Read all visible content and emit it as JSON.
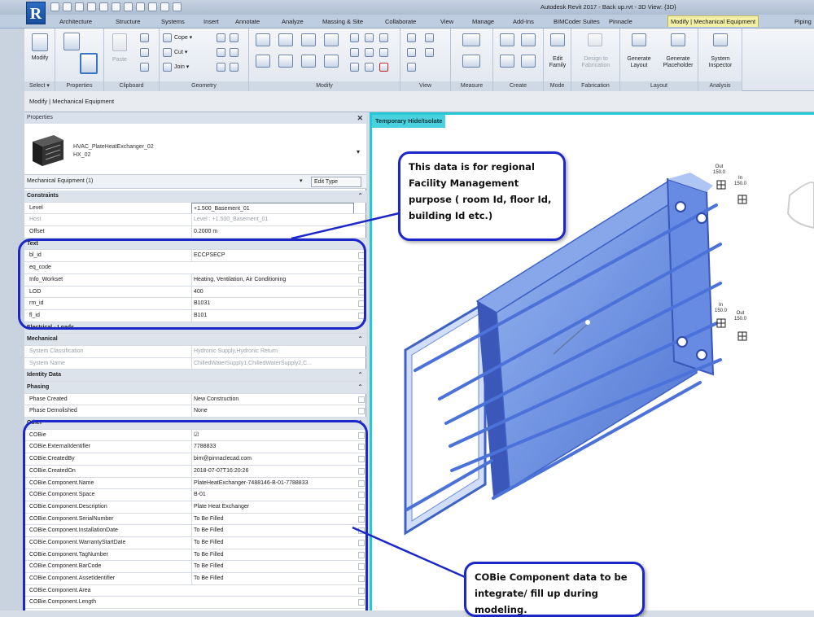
{
  "window": {
    "app_title": "Autodesk Revit 2017 -    Back up.rvt - 3D View: {3D}",
    "logo": "R"
  },
  "ribbon_tabs": [
    "Architecture",
    "Structure",
    "Systems",
    "Insert",
    "Annotate",
    "Analyze",
    "Massing & Site",
    "Collaborate",
    "View",
    "Manage",
    "Add-Ins",
    "BIMCoder Suites",
    "Pinnacle",
    "Modify | Mechanical Equipment",
    "Piping"
  ],
  "ribbon_groups": {
    "select": {
      "label": "Select ▾",
      "modify_label": "Modify"
    },
    "properties": {
      "label": "Properties"
    },
    "clipboard": {
      "label": "Clipboard",
      "paste": "Paste"
    },
    "geometry": {
      "label": "Geometry",
      "cope": "Cope ▾",
      "cut": "Cut ▾",
      "join": "Join ▾"
    },
    "modify": {
      "label": "Modify"
    },
    "view": {
      "label": "View"
    },
    "measure": {
      "label": "Measure"
    },
    "create": {
      "label": "Create"
    },
    "mode": {
      "label": "Mode",
      "edit_family": "Edit\nFamily"
    },
    "fabrication": {
      "label": "Fabrication",
      "design_to_fab": "Design to\nFabrication"
    },
    "layout": {
      "label": "Layout",
      "generate_layout": "Generate\nLayout",
      "generate_placeholder": "Generate\nPlaceholder"
    },
    "analysis": {
      "label": "Analysis",
      "system_inspector": "System\nInspector"
    }
  },
  "context_bar": "Modify | Mechanical Equipment",
  "properties": {
    "panel_title": "Properties",
    "type_name_line1": "HVAC_PlateHeatExchanger_02",
    "type_name_line2": "HX_02",
    "selector": "Mechanical Equipment (1)",
    "edit_type": "Edit Type",
    "rows": [
      {
        "kind": "sec",
        "k": "Constraints"
      },
      {
        "k": "Level",
        "v": "+1.500_Basement_01",
        "input": true
      },
      {
        "k": "Host",
        "v": "Level : +1.500_Basement_01",
        "dim": true
      },
      {
        "k": "Offset",
        "v": "0.2000 m"
      },
      {
        "kind": "sec",
        "k": "Text"
      },
      {
        "k": "bl_id",
        "v": "ECCPSECP"
      },
      {
        "k": "eq_code",
        "v": ""
      },
      {
        "k": "Info_Workset",
        "v": "Heating, Ventilation, Air Conditioning"
      },
      {
        "k": "LOD",
        "v": "400"
      },
      {
        "k": "rm_id",
        "v": "B1031"
      },
      {
        "k": "fl_id",
        "v": "B101"
      },
      {
        "kind": "sec",
        "k": "Electrical - Loads"
      },
      {
        "kind": "sec",
        "k": "Mechanical"
      },
      {
        "k": "System Classification",
        "v": "Hydronic Supply,Hydronic Return",
        "dim": true
      },
      {
        "k": "System Name",
        "v": "ChilledWaterSupply1,ChilledWaterSupply2,C...",
        "dim": true
      },
      {
        "kind": "sec",
        "k": "Identity Data"
      },
      {
        "kind": "sec",
        "k": "Phasing"
      },
      {
        "k": "Phase Created",
        "v": "New Construction"
      },
      {
        "k": "Phase Demolished",
        "v": "None"
      },
      {
        "kind": "sec",
        "k": "Other"
      },
      {
        "k": "COBie",
        "v": "☑"
      },
      {
        "k": "COBie.ExternalIdentifier",
        "v": "7788833"
      },
      {
        "k": "COBie.CreatedBy",
        "v": "bim@pinnaclecad.com"
      },
      {
        "k": "COBie.CreatedOn",
        "v": "2018-07-07T16:20:26"
      },
      {
        "k": "COBie.Component.Name",
        "v": "PlateHeatExchanger-7488146-B-01-7788833"
      },
      {
        "k": "COBie.Component.Space",
        "v": "B-01"
      },
      {
        "k": "COBie.Component.Description",
        "v": "Plate Heat Exchanger"
      },
      {
        "k": "COBie.Component.SerialNumber",
        "v": "To Be Filled"
      },
      {
        "k": "COBie.Component.InstallationDate",
        "v": "To Be Filled"
      },
      {
        "k": "COBie.Component.WarrantyStartDate",
        "v": "To Be Filled"
      },
      {
        "k": "COBie.Component.TagNumber",
        "v": "To Be Filled"
      },
      {
        "k": "COBie.Component.BarCode",
        "v": "To Be Filled"
      },
      {
        "k": "COBie.Component.AssetIdentifier",
        "v": "To Be Filled"
      },
      {
        "k": "COBie.Component.Area",
        "v": ""
      },
      {
        "k": "COBie.Component.Length",
        "v": ""
      }
    ]
  },
  "viewport": {
    "temp_label": "Temporary Hide/Isolate",
    "callout_top": "This data is for regional Facility Management purpose ( room Id, floor Id, building Id etc.)",
    "callout_bottom": "COBie Component data to be integrate/ fill up during modeling.",
    "connectors": [
      {
        "t1": "Out",
        "t2": "150.0",
        "t3": "In",
        "t4": "150.0"
      },
      {
        "t1": "In",
        "t2": "150.0",
        "t3": "Out",
        "t4": "150.0"
      }
    ]
  },
  "colors": {
    "callout_border": "#1b27c9",
    "isolate_border": "#27c8d6",
    "model_blue": "#3f6fd8"
  }
}
